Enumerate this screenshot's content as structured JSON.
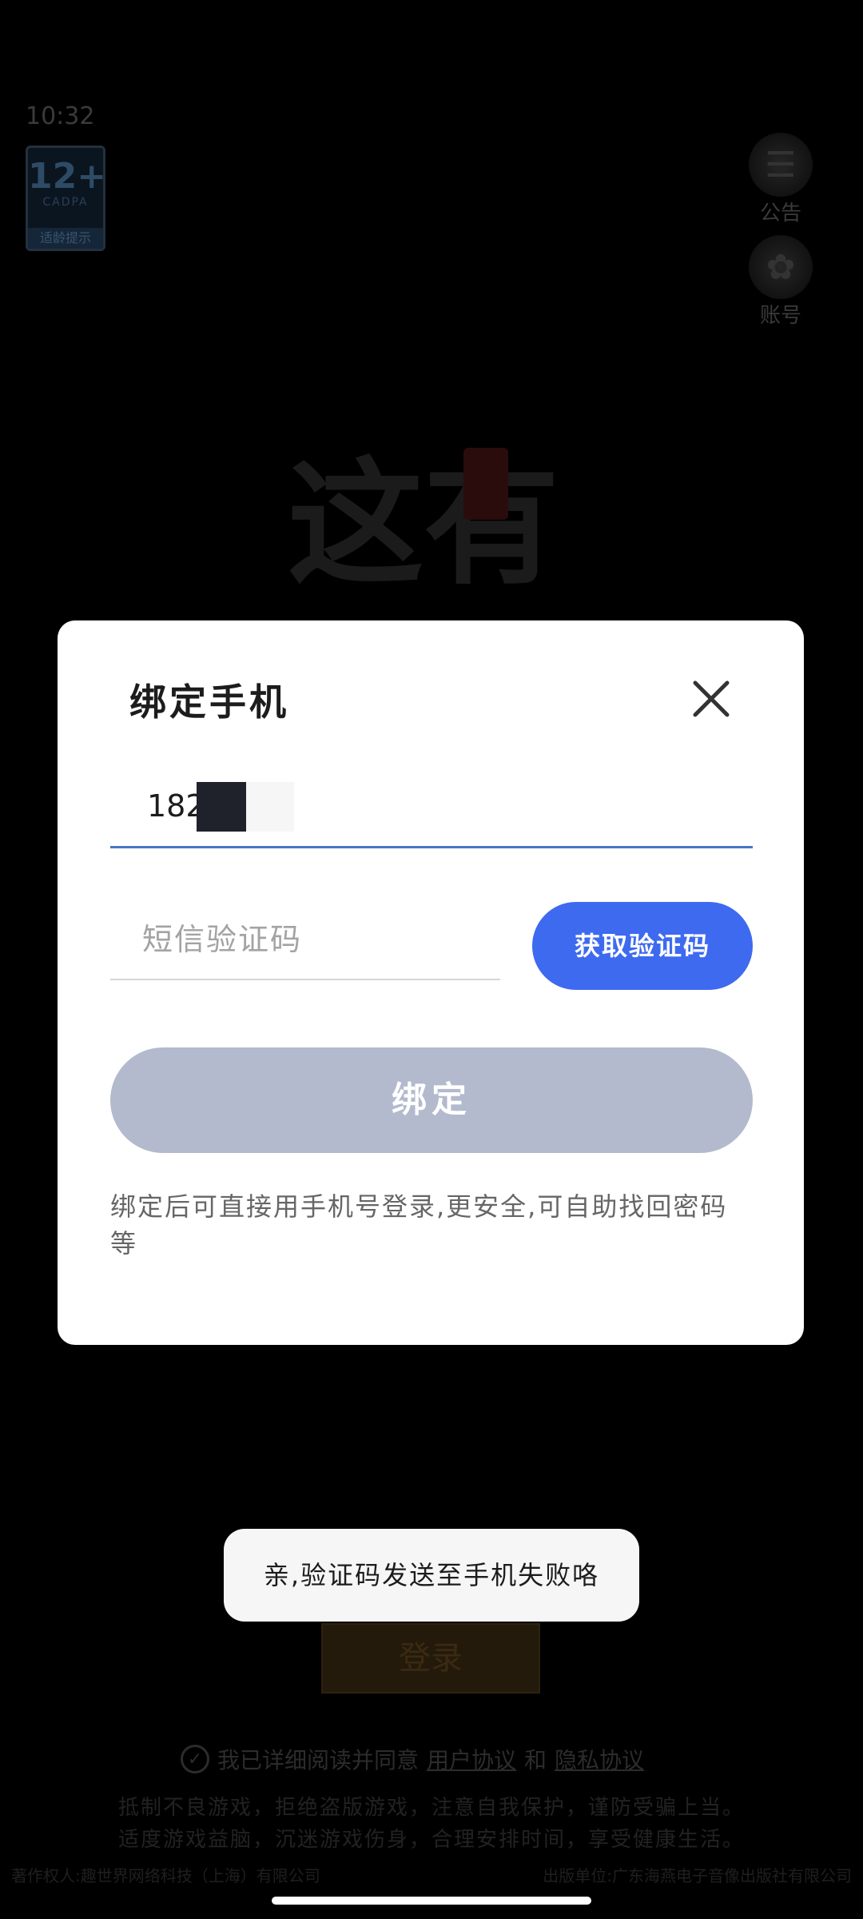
{
  "status_bar": {
    "time": "10:32"
  },
  "age_rating": {
    "rating": "12+",
    "org": "CADPA",
    "tip": "适龄提示"
  },
  "side_buttons": {
    "notice": "公告",
    "account": "账号"
  },
  "background": {
    "logo_text": "这有",
    "login_button": "登录",
    "agreement": {
      "prefix": "我已详细阅读并同意",
      "user_agreement": "用户协议",
      "and": "和",
      "privacy": "隐私协议"
    },
    "health_line1": "抵制不良游戏，拒绝盗版游戏，注意自我保护，谨防受骗上当。",
    "health_line2": "适度游戏益脑，沉迷游戏伤身，合理安排时间，享受健康生活。",
    "copyright_left": "著作权人:趣世界网络科技（上海）有限公司",
    "copyright_right": "出版单位:广东海燕电子音像出版社有限公司"
  },
  "modal": {
    "title": "绑定手机",
    "phone_value": "182",
    "code_placeholder": "短信验证码",
    "get_code_label": "获取验证码",
    "bind_label": "绑定",
    "hint": "绑定后可直接用手机号登录,更安全,可自助找回密码等"
  },
  "toast": {
    "message": "亲,验证码发送至手机失败咯"
  },
  "colors": {
    "primary": "#3e6af0",
    "disabled_button": "#b3bacd",
    "underline_active": "#4a74c9"
  }
}
